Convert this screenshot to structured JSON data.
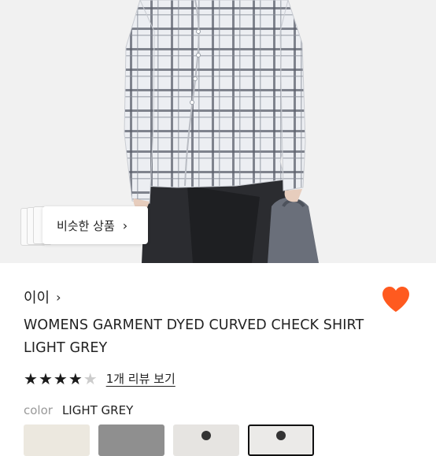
{
  "similar_button": {
    "label": "비슷한 상품",
    "chevron": "chevron-right-icon"
  },
  "brand": {
    "name": "이이",
    "chevron": "chevron-right-icon"
  },
  "wishlist": {
    "icon": "heart-icon",
    "active": true,
    "color": "#ff5a1f"
  },
  "product": {
    "title": "WOMENS GARMENT DYED CURVED CHECK SHIRT LIGHT GREY"
  },
  "rating": {
    "stars": 4,
    "max": 5,
    "review_link": "1개 리뷰 보기"
  },
  "color": {
    "label": "color",
    "value": "LIGHT GREY"
  },
  "swatches": [
    {
      "name": "swatch-1",
      "color": "#ece8df"
    },
    {
      "name": "swatch-2",
      "color": "#8f8f8f"
    },
    {
      "name": "swatch-3",
      "color": "#e6e4e1"
    },
    {
      "name": "swatch-4",
      "color": "#ebeae8",
      "selected": true
    }
  ]
}
